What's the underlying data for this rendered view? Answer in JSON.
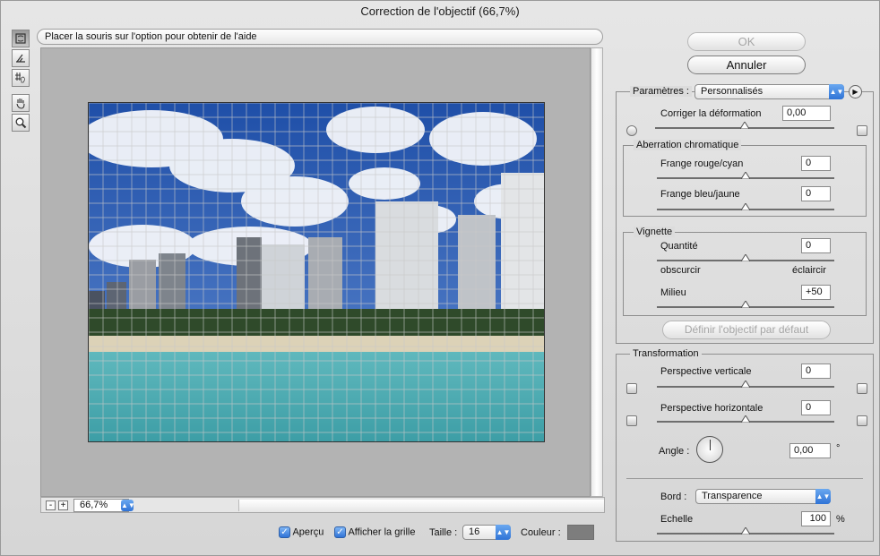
{
  "window": {
    "title": "Correction de l'objectif (66,7%)"
  },
  "toolbar": {
    "tools": [
      {
        "icon": "remove-distortion-icon"
      },
      {
        "icon": "straighten-icon"
      },
      {
        "icon": "move-grid-icon"
      },
      {
        "icon": "hand-icon"
      },
      {
        "icon": "zoom-icon"
      }
    ]
  },
  "help": {
    "text": "Placer la souris sur l'option pour obtenir de l'aide"
  },
  "zoom": {
    "minus": "-",
    "plus": "+",
    "value": "66,7%"
  },
  "bottom": {
    "preview_label": "Aperçu",
    "preview_checked": true,
    "grid_label": "Afficher la grille",
    "grid_checked": true,
    "size_label": "Taille :",
    "size_value": "16",
    "color_label": "Couleur :",
    "color_value": "#7d7d7d"
  },
  "buttons": {
    "ok": "OK",
    "cancel": "Annuler",
    "default_lens": "Définir l'objectif par défaut"
  },
  "settings": {
    "label": "Paramètres :",
    "value": "Personnalisés",
    "distortion_label": "Corriger la déformation",
    "distortion_value": "0,00"
  },
  "chromatic": {
    "title": "Aberration chromatique",
    "red_cyan_label": "Frange rouge/cyan",
    "red_cyan_value": "0",
    "blue_yellow_label": "Frange bleu/jaune",
    "blue_yellow_value": "0"
  },
  "vignette": {
    "title": "Vignette",
    "amount_label": "Quantité",
    "amount_value": "0",
    "darken_label": "obscurcir",
    "lighten_label": "éclaircir",
    "midpoint_label": "Milieu",
    "midpoint_value": "+50"
  },
  "transform": {
    "title": "Transformation",
    "vertical_label": "Perspective verticale",
    "vertical_value": "0",
    "horizontal_label": "Perspective horizontale",
    "horizontal_value": "0",
    "angle_label": "Angle :",
    "angle_value": "0,00",
    "angle_unit": "°",
    "edge_label": "Bord :",
    "edge_value": "Transparence",
    "scale_label": "Echelle",
    "scale_value": "100",
    "scale_unit": "%"
  }
}
